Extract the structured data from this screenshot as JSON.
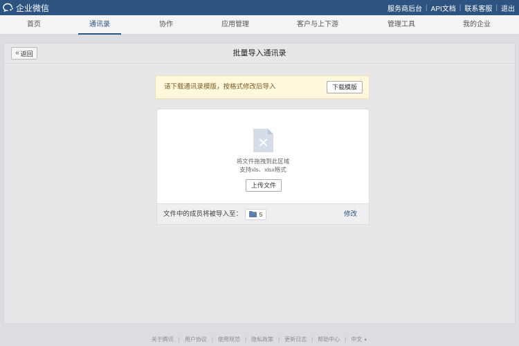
{
  "app": {
    "name": "企业微信"
  },
  "top_links": [
    "服务商后台",
    "API文档",
    "联系客服",
    "退出"
  ],
  "nav": {
    "tabs": [
      {
        "label": "首页",
        "active": false
      },
      {
        "label": "通讯录",
        "active": true
      },
      {
        "label": "协作",
        "active": false
      },
      {
        "label": "应用管理",
        "active": false
      },
      {
        "label": "客户与上下游",
        "active": false
      },
      {
        "label": "管理工具",
        "active": false
      },
      {
        "label": "我的企业",
        "active": false
      }
    ]
  },
  "page": {
    "back_label": "返回",
    "title": "批量导入通讯录"
  },
  "import": {
    "notice": "请下载通讯录模版，按格式修改后导入",
    "download_template_label": "下载模版",
    "dropzone_hint": "将文件拖拽到此区域",
    "dropzone_formats": "支持xls、xlsx格式",
    "upload_label": "上传文件",
    "target_label": "文件中的成员将被导入至：",
    "department_count": "5",
    "modify_label": "修改"
  },
  "footer": {
    "links": [
      "关于腾讯",
      "用户协议",
      "使用规范",
      "隐私政策",
      "更新日志",
      "帮助中心"
    ],
    "language": "中文"
  },
  "colors": {
    "topbar": "#2d5380",
    "accent": "#2d5380",
    "notice_bg": "#fff8dc",
    "notice_text": "#7b5a22"
  }
}
